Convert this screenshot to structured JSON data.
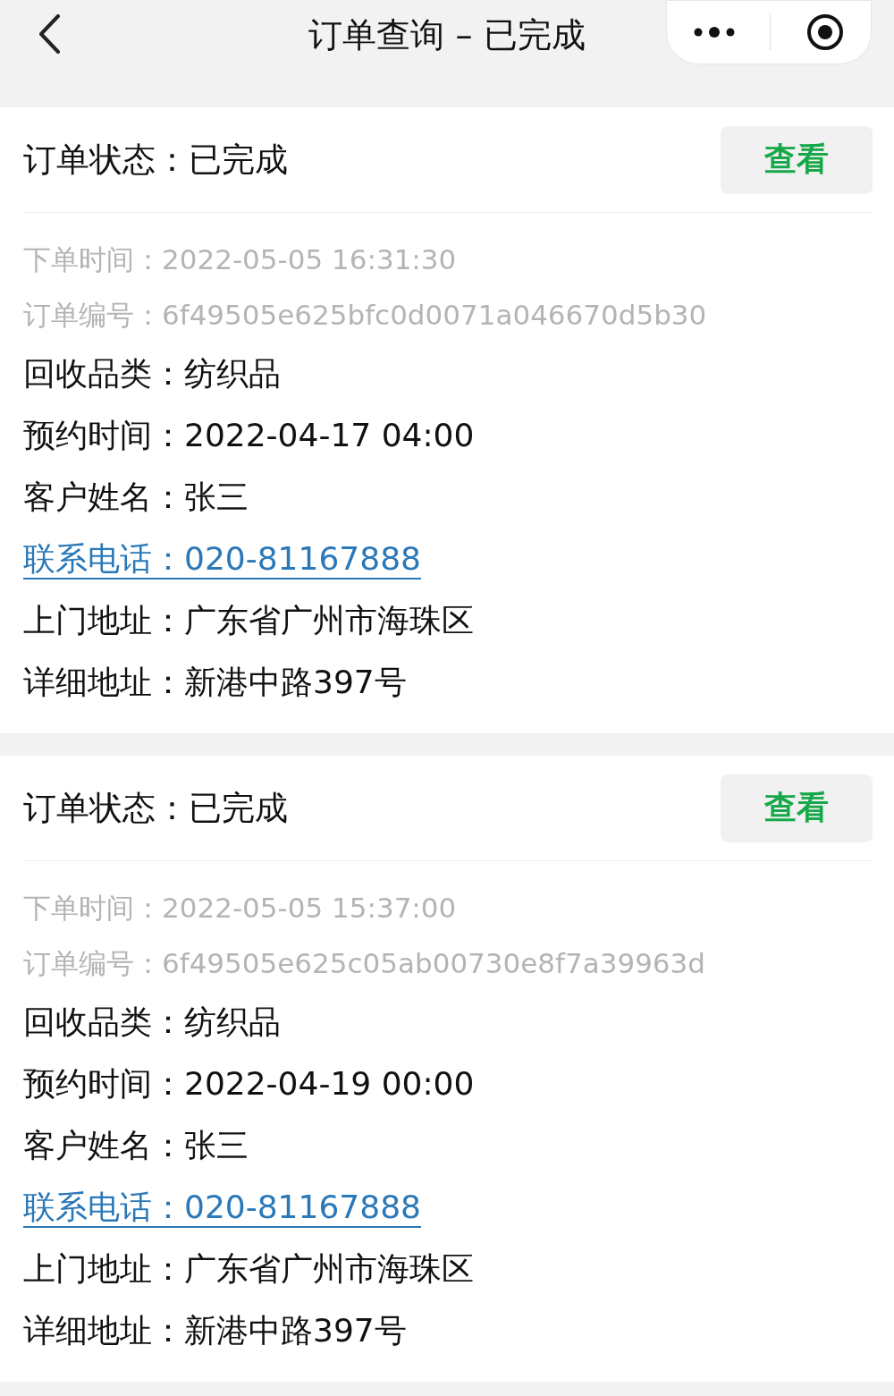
{
  "nav": {
    "title": "订单查询 – 已完成"
  },
  "orders": [
    {
      "status_label": "订单状态：",
      "status": "已完成",
      "view_button": "查看",
      "fields": [
        {
          "kind": "meta",
          "label": "下单时间：",
          "value": "2022-05-05 16:31:30"
        },
        {
          "kind": "meta",
          "label": "订单编号：",
          "value": "6f49505e625bfc0d0071a046670d5b30"
        },
        {
          "kind": "normal",
          "label": "回收品类：",
          "value": "纺织品"
        },
        {
          "kind": "normal",
          "label": "预约时间：",
          "value": "2022-04-17 04:00"
        },
        {
          "kind": "normal",
          "label": "客户姓名：",
          "value": "张三"
        },
        {
          "kind": "link",
          "label": "联系电话：",
          "value": "020-81167888"
        },
        {
          "kind": "normal",
          "label": "上门地址：",
          "value": "广东省广州市海珠区"
        },
        {
          "kind": "normal",
          "label": "详细地址：",
          "value": "新港中路397号"
        }
      ]
    },
    {
      "status_label": "订单状态：",
      "status": "已完成",
      "view_button": "查看",
      "fields": [
        {
          "kind": "meta",
          "label": "下单时间：",
          "value": "2022-05-05 15:37:00"
        },
        {
          "kind": "meta",
          "label": "订单编号：",
          "value": "6f49505e625c05ab00730e8f7a39963d"
        },
        {
          "kind": "normal",
          "label": "回收品类：",
          "value": "纺织品"
        },
        {
          "kind": "normal",
          "label": "预约时间：",
          "value": "2022-04-19 00:00"
        },
        {
          "kind": "normal",
          "label": "客户姓名：",
          "value": "张三"
        },
        {
          "kind": "link",
          "label": "联系电话：",
          "value": "020-81167888"
        },
        {
          "kind": "normal",
          "label": "上门地址：",
          "value": "广东省广州市海珠区"
        },
        {
          "kind": "normal",
          "label": "详细地址：",
          "value": "新港中路397号"
        }
      ]
    }
  ]
}
